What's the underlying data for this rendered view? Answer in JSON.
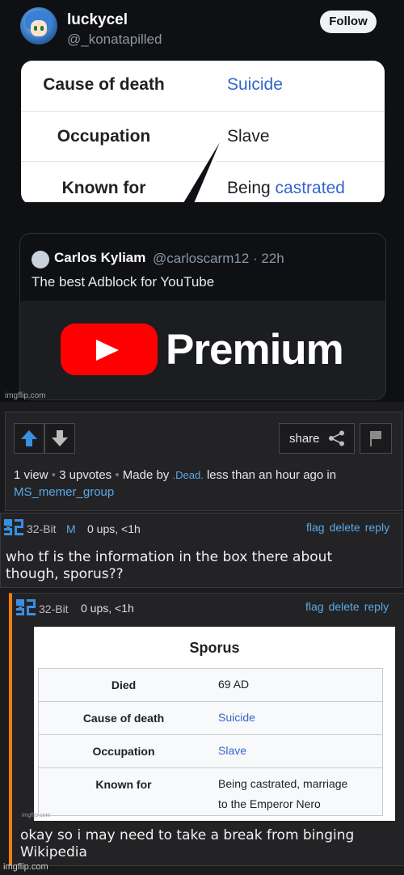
{
  "tweet": {
    "username": "luckycel",
    "handle": "@_konatapilled",
    "follow_label": "Follow",
    "table": [
      {
        "label": "Cause of death",
        "value": "Suicide",
        "value_is_link": true
      },
      {
        "label": "Occupation",
        "value": "Slave"
      },
      {
        "label": "Known for",
        "value_prefix": "Being ",
        "value_link": "castrated"
      }
    ],
    "quote": {
      "name": "Carlos Kyliam",
      "handle_time": "@carloscarm12 · 22h",
      "text": "The best Adblock for YouTube",
      "brand_text": "Premium"
    },
    "watermark": "imgflip.com"
  },
  "post": {
    "share_label": "share",
    "stats": {
      "views": "1 view",
      "upvotes": "3 upvotes",
      "made_by": "Made by",
      "author": ".Dead.",
      "time": "less than an hour ago in",
      "stream": "MS_memer_group"
    }
  },
  "comments": [
    {
      "user": "32-Bit",
      "mod_badge": "M",
      "meta": "0 ups, <1h",
      "actions": [
        "flag",
        "delete",
        "reply"
      ],
      "text_line1": "who tf is the information in the box there about",
      "text_line2": "though, sporus??"
    },
    {
      "user": "32-Bit",
      "meta": "0 ups, <1h",
      "actions": [
        "flag",
        "delete",
        "reply"
      ],
      "wiki": {
        "title": "Sporus",
        "rows": [
          {
            "label": "Died",
            "value": "69 AD"
          },
          {
            "label": "Cause of death",
            "value": "Suicide",
            "link": true
          },
          {
            "label": "Occupation",
            "value": "Slave",
            "link": true
          },
          {
            "label": "Known for",
            "value_line1": "Being castrated, marriage",
            "value_line2": "to the Emperor Nero"
          }
        ],
        "watermark": "imgflip.com"
      },
      "text_line1": "okay so i may need to take a break from binging",
      "text_line2": "Wikipedia"
    }
  ],
  "footer_watermark": "imgflip.com",
  "colors": {
    "link": "#3366cc",
    "accent": "#5aa9e6",
    "youtube_red": "#ff0000",
    "orange_bar": "#f27d0c"
  }
}
